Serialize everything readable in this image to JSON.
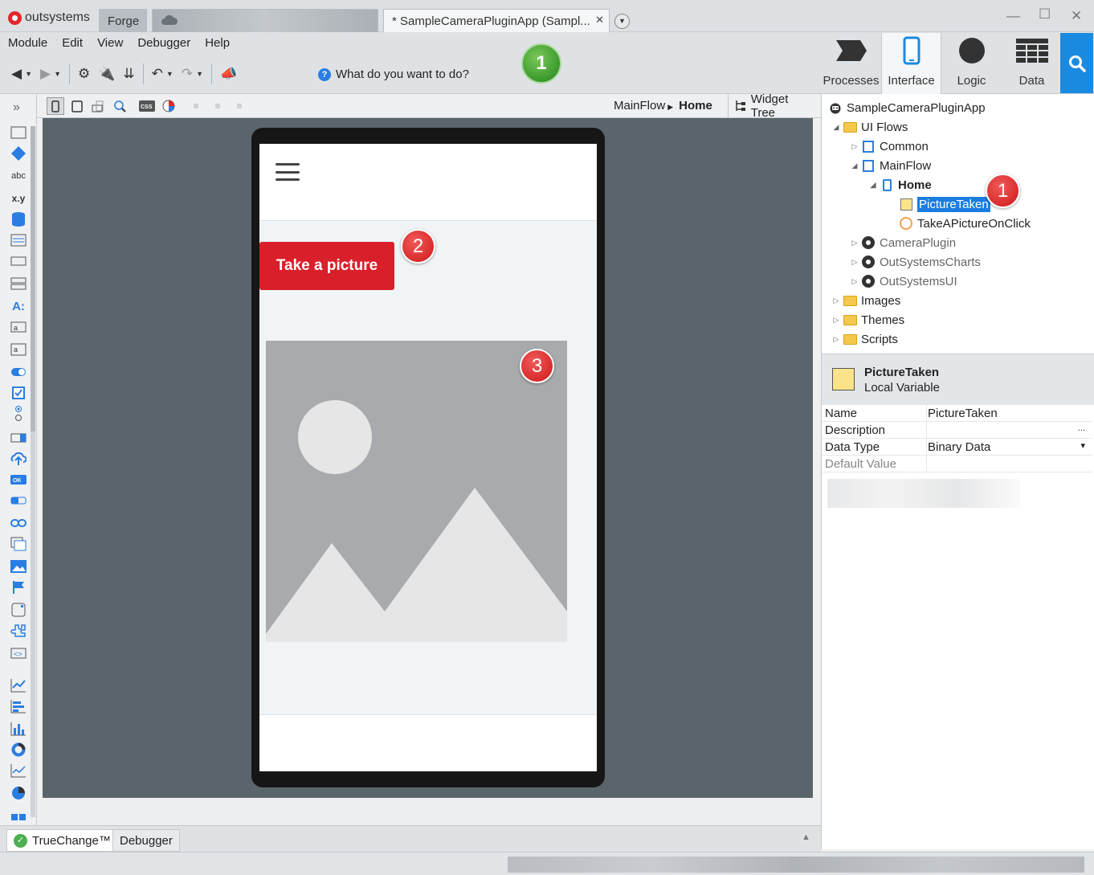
{
  "app": {
    "brand": "outsystems",
    "tabs": [
      {
        "label": "Forge"
      },
      {
        "label": ""
      },
      {
        "label": "* SampleCameraPluginApp (Sampl..."
      }
    ]
  },
  "window_controls": {
    "minimize": "—",
    "maximize": "☐",
    "close": "✕"
  },
  "menu": [
    "Module",
    "Edit",
    "View",
    "Debugger",
    "Help"
  ],
  "toolbar": {
    "search_prompt": "What do you want to do?",
    "step_badge": "1"
  },
  "top_tabs": [
    {
      "label": "Processes",
      "icon": "processes-icon"
    },
    {
      "label": "Interface",
      "icon": "interface-icon"
    },
    {
      "label": "Logic",
      "icon": "logic-icon"
    },
    {
      "label": "Data",
      "icon": "data-icon"
    }
  ],
  "breadcrumb": {
    "flow": "MainFlow",
    "screen": "Home"
  },
  "widget_tree_label": "Widget Tree",
  "canvas": {
    "button_label": "Take a picture",
    "badge_2": "2",
    "badge_3": "3"
  },
  "tree": {
    "root": "SampleCameraPluginApp",
    "ui_flows": "UI Flows",
    "common": "Common",
    "mainflow": "MainFlow",
    "home": "Home",
    "picture_taken": "PictureTaken",
    "take_a_picture_on_click": "TakeAPictureOnClick",
    "camera_plugin": "CameraPlugin",
    "outsystems_charts": "OutSystemsCharts",
    "outsystems_ui": "OutSystemsUI",
    "images": "Images",
    "themes": "Themes",
    "scripts": "Scripts",
    "badge_1": "1"
  },
  "detail": {
    "name": "PictureTaken",
    "type": "Local Variable",
    "properties": [
      {
        "key": "Name",
        "value": "PictureTaken"
      },
      {
        "key": "Description",
        "value": ""
      },
      {
        "key": "Data Type",
        "value": "Binary Data"
      },
      {
        "key": "Default Value",
        "value": ""
      }
    ],
    "description_more": "...",
    "datatype_caret": "▾"
  },
  "bottom_tabs": {
    "truechange": "TrueChange™",
    "debugger": "Debugger"
  },
  "colors": {
    "accent": "#1a8ae0",
    "button_red": "#d91f2a",
    "badge_green": "#3a9a2c",
    "canvas_bg": "#5a656b"
  }
}
